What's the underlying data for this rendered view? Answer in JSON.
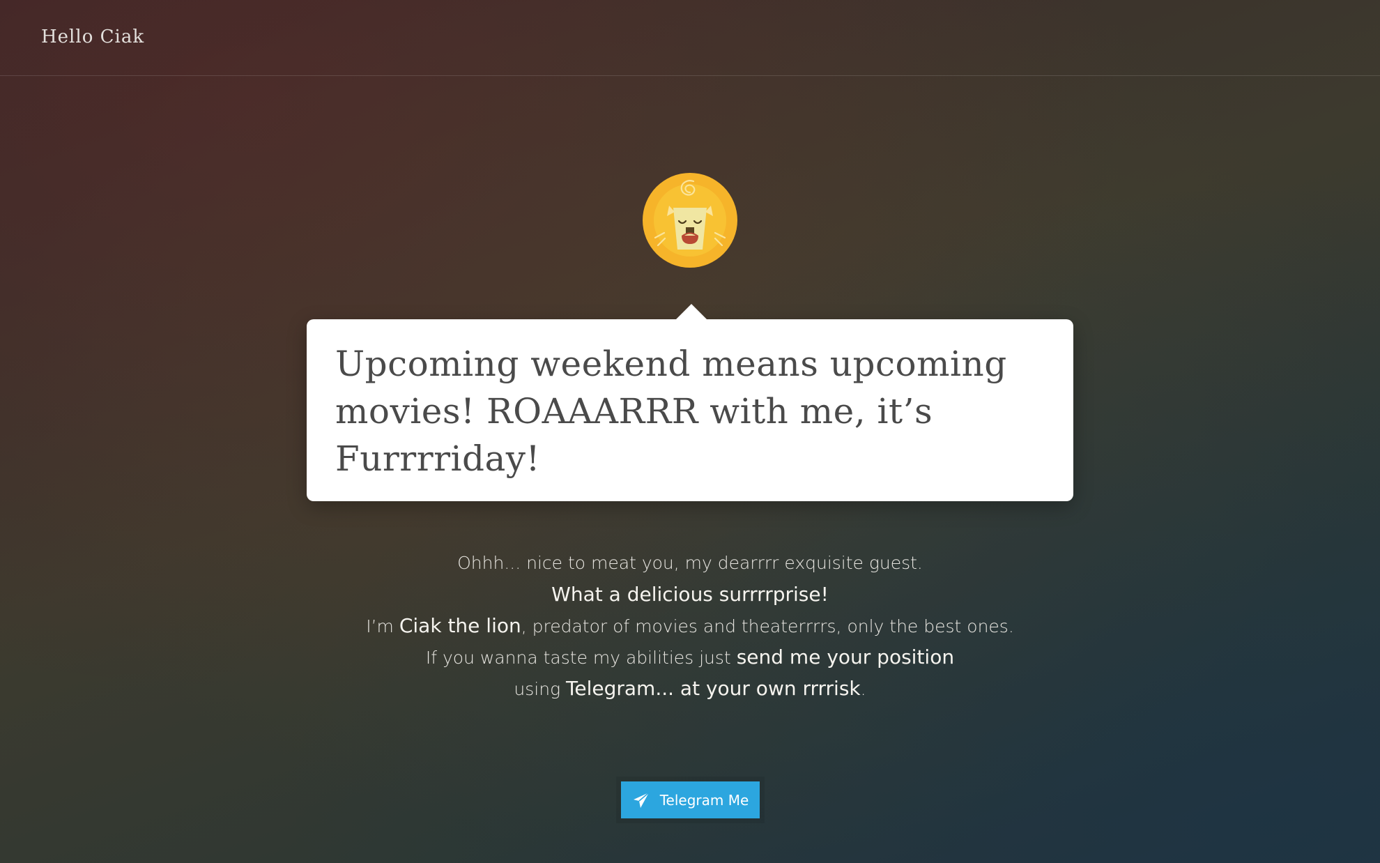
{
  "header": {
    "brand": "Hello Ciak"
  },
  "bubble": {
    "text": "Upcoming weekend means upcoming movies! ROAAARRR with me, it’s Furrrriday!"
  },
  "intro": {
    "line1": "Ohhh... nice to meat you, my dearrrr exquisite guest.",
    "line2": "What a delicious surrrrprise!",
    "line3_a": "I’m ",
    "line3_b": "Ciak the lion",
    "line3_c": ", predator of movies and theaterrrrs, only the best ones.",
    "line4_a": "If you wanna taste my abilities just ",
    "line4_b": "send me your position",
    "line5_a": "using ",
    "line5_b": "Telegram... at your own rrrrisk",
    "line5_c": "."
  },
  "cta": {
    "label": "Telegram Me",
    "icon": "paper-plane-icon"
  },
  "avatar": {
    "icon": "lion-face-icon"
  },
  "colors": {
    "button": "#2ca6df",
    "avatar": "#f6b42a",
    "bubble": "#ffffff"
  }
}
